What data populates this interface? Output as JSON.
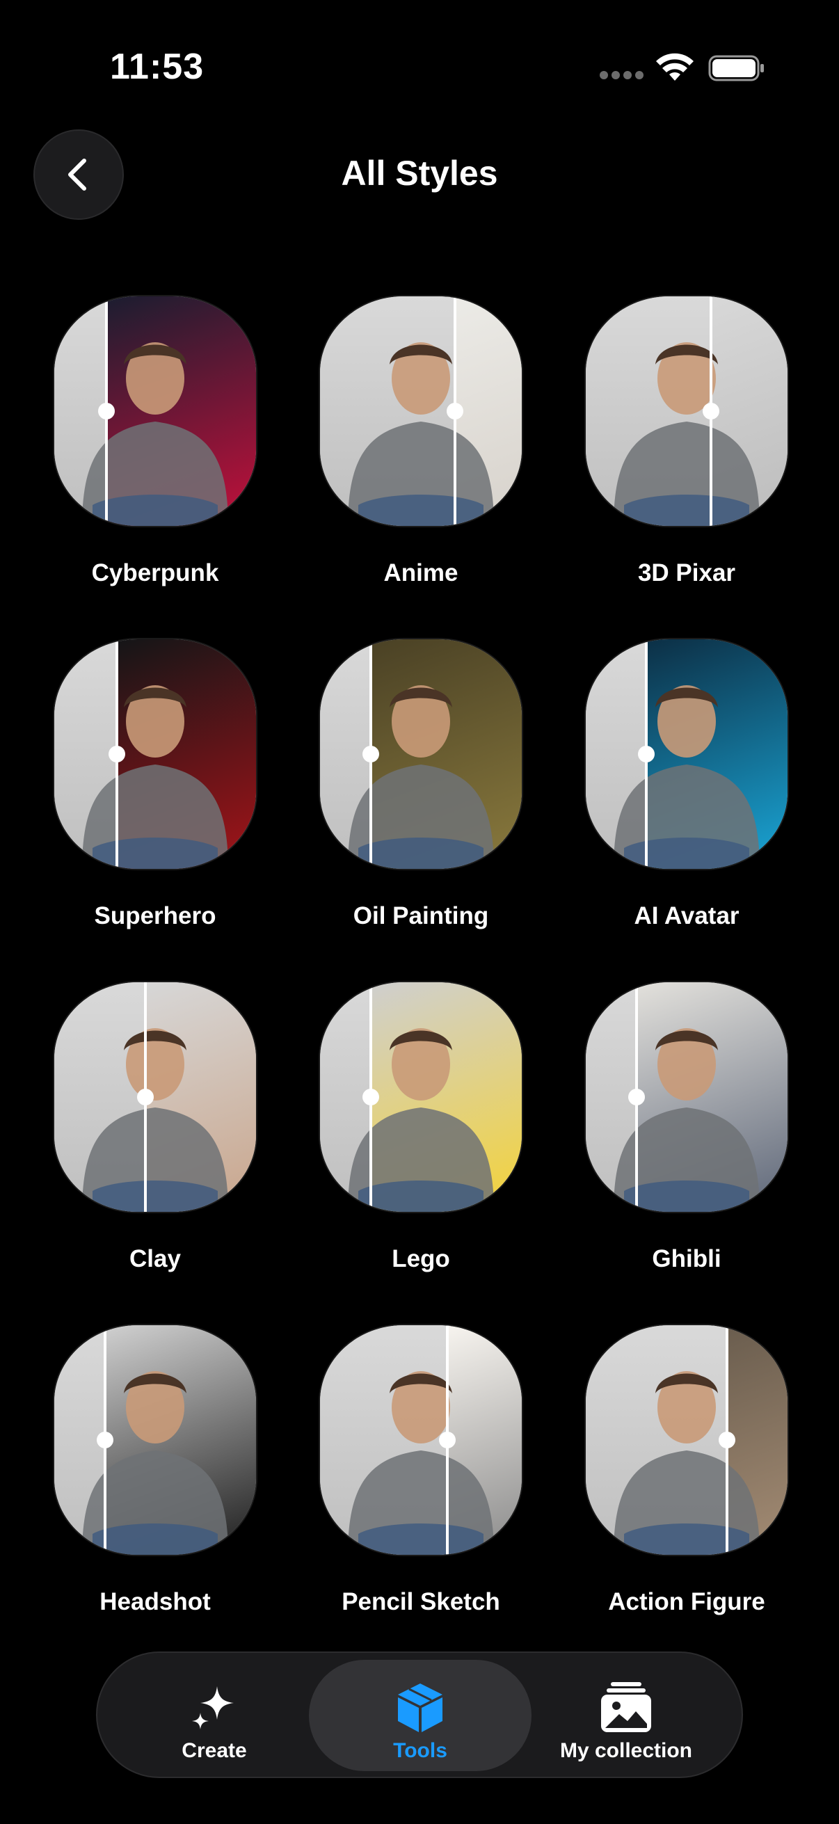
{
  "status_bar": {
    "time": "11:53"
  },
  "header": {
    "title": "All Styles"
  },
  "styles": [
    {
      "label": "Cyberpunk",
      "split": 0.26,
      "right_color": "#1b1d30",
      "accent": "#c4103b"
    },
    {
      "label": "Anime",
      "split": 0.67,
      "right_color": "#ecebe7",
      "accent": "#d7d2cb"
    },
    {
      "label": "3D Pixar",
      "split": 0.62,
      "right_color": "#d8d8d8",
      "accent": "#bcbcbc"
    },
    {
      "label": "Superhero",
      "split": 0.31,
      "right_color": "#141517",
      "accent": "#a51419"
    },
    {
      "label": "Oil Painting",
      "split": 0.25,
      "right_color": "#4a4125",
      "accent": "#8a7a3d"
    },
    {
      "label": "AI Avatar",
      "split": 0.3,
      "right_color": "#0c2f45",
      "accent": "#1aa7d8"
    },
    {
      "label": "Clay",
      "split": 0.45,
      "right_color": "#d7d7d7",
      "accent": "#c9a58b"
    },
    {
      "label": "Lego",
      "split": 0.25,
      "right_color": "#cfcfcf",
      "accent": "#f4d337"
    },
    {
      "label": "Ghibli",
      "split": 0.25,
      "right_color": "#e3e1dc",
      "accent": "#5d6678"
    },
    {
      "label": "Headshot",
      "split": 0.25,
      "right_color": "#d0d0d0",
      "accent": "#1c1c1c"
    },
    {
      "label": "Pencil Sketch",
      "split": 0.63,
      "right_color": "#f7f4ef",
      "accent": "#8a8a8a"
    },
    {
      "label": "Action Figure",
      "split": 0.7,
      "right_color": "#6a5d4e",
      "accent": "#a48c74"
    }
  ],
  "tab_bar": {
    "tabs": [
      {
        "label": "Create",
        "icon": "sparkle-icon",
        "active": false
      },
      {
        "label": "Tools",
        "icon": "cube-icon",
        "active": true
      },
      {
        "label": "My collection",
        "icon": "photo-stack-icon",
        "active": false
      }
    ]
  },
  "colors": {
    "accent": "#1a9bff",
    "background": "#000000",
    "tab_bar": "#1b1b1d"
  }
}
